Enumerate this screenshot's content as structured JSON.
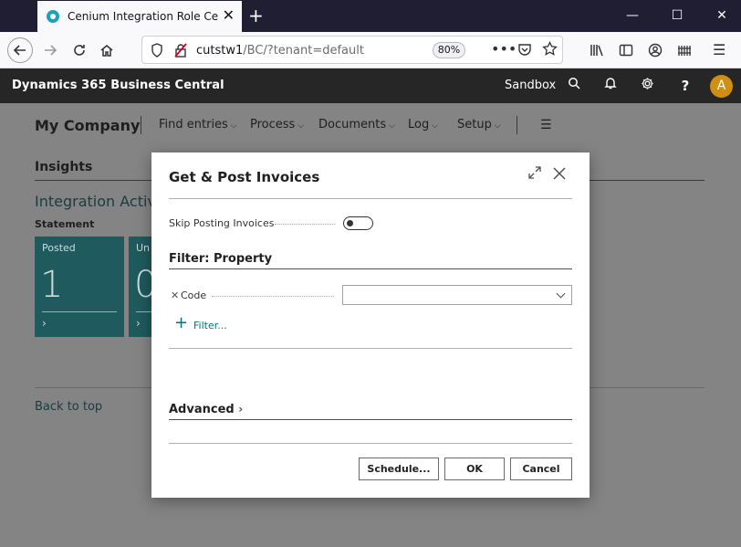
{
  "browser": {
    "tab_title": "Cenium Integration Role Cente",
    "tab_close": "✕",
    "new_tab": "+",
    "url_host": "cutstw1",
    "url_path": "/BC/?tenant=default",
    "zoom": "80%",
    "window_controls": [
      "—",
      "☐",
      "✕"
    ]
  },
  "app": {
    "title": "Dynamics 365 Business Central",
    "environment": "Sandbox",
    "avatar_initial": "A",
    "icons": [
      "search-icon",
      "bell-icon",
      "gear-icon",
      "help-icon"
    ]
  },
  "page": {
    "company": "My Company",
    "menu": [
      "Find entries",
      "Process",
      "Documents",
      "Log",
      "Setup"
    ],
    "insights": "Insights",
    "integration_activities": "Integration Activiti",
    "statement": "Statement",
    "tiles": [
      {
        "label": "Posted",
        "value": "1"
      },
      {
        "label": "Un",
        "value": "0"
      }
    ],
    "back_to_top": "Back to top"
  },
  "dialog": {
    "title": "Get & Post Invoices",
    "skip_posting_label": "Skip Posting Invoices",
    "skip_posting_value": false,
    "filter_title": "Filter: Property",
    "code_label": "Code",
    "code_value": "",
    "filter_link": "Filter...",
    "advanced": "Advanced",
    "buttons": {
      "schedule": "Schedule...",
      "ok": "OK",
      "cancel": "Cancel"
    }
  },
  "colors": {
    "accent": "#00737c",
    "tile": "#1e5a5e",
    "avatar": "#cf8f12",
    "header": "#262626"
  }
}
